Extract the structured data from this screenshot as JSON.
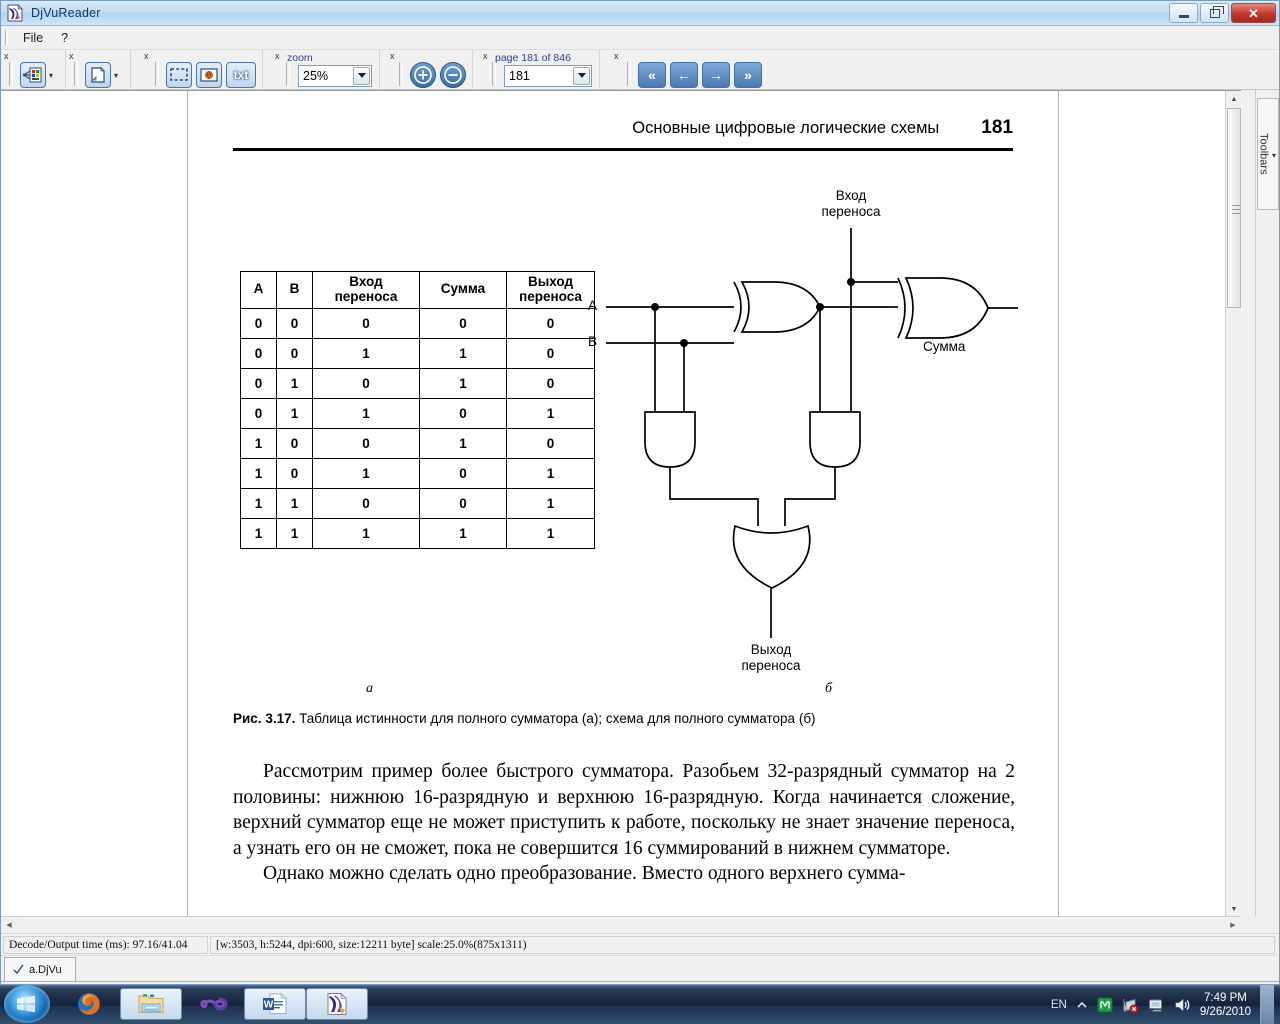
{
  "window": {
    "title": "DjVuReader",
    "icon": "djvu-document-icon",
    "buttons": {
      "minimize": "–",
      "maximize": "❐",
      "close": "✕"
    }
  },
  "menubar": {
    "items": [
      "File",
      "?"
    ]
  },
  "toolbar": {
    "close_glyph": "x",
    "groups": [
      {
        "name": "display-mode",
        "buttons": [
          "display-mode-icon"
        ],
        "has_dropdown": true
      },
      {
        "name": "page-layout",
        "buttons": [
          "page-layout-icon"
        ],
        "has_dropdown": true
      },
      {
        "name": "tools",
        "buttons": [
          "select-area-icon",
          "image-mode-icon",
          "txt"
        ]
      }
    ],
    "zoom": {
      "label": "zoom",
      "value": "25%"
    },
    "zoom_in": "+",
    "zoom_out": "−",
    "page": {
      "label": "page 181 of 846",
      "value": "181"
    },
    "nav": {
      "first": "«",
      "prev": "←",
      "next": "→",
      "last": "»"
    }
  },
  "dock": {
    "label": "Toolbars",
    "chevron": "▾"
  },
  "statusbar": {
    "left": "Decode/Output time (ms): 97.16/41.04",
    "right": "[w:3503, h:5244, dpi:600, size:12211 byte] scale:25.0%(875x1311)"
  },
  "tabstrip": {
    "tab_name": "a.DjVu",
    "tab_icon": "checkmark-icon"
  },
  "scrollbars": {
    "up": "▲",
    "down": "▼",
    "left": "◀",
    "right": "▶"
  },
  "document": {
    "running_head": "Основные цифровые логические схемы",
    "page_number": "181",
    "truth_table": {
      "headers": [
        "A",
        "B",
        "Вход переноса",
        "Сумма",
        "Выход переноса"
      ],
      "rows": [
        [
          "0",
          "0",
          "0",
          "0",
          "0"
        ],
        [
          "0",
          "0",
          "1",
          "1",
          "0"
        ],
        [
          "0",
          "1",
          "0",
          "1",
          "0"
        ],
        [
          "0",
          "1",
          "1",
          "0",
          "1"
        ],
        [
          "1",
          "0",
          "0",
          "1",
          "0"
        ],
        [
          "1",
          "0",
          "1",
          "0",
          "1"
        ],
        [
          "1",
          "1",
          "0",
          "0",
          "1"
        ],
        [
          "1",
          "1",
          "1",
          "1",
          "1"
        ]
      ]
    },
    "circuit": {
      "input_a": "A",
      "input_b": "B",
      "carry_in": "Вход\nпереноса",
      "sum": "Сумма",
      "carry_out": "Выход\nпереноса"
    },
    "sublabel_a": "а",
    "sublabel_b": "б",
    "caption_bold": "Рис. 3.17.",
    "caption_text": " Таблица истинности для полного сумматора (а); схема для полного сумматора (б)",
    "paragraphs": [
      "Рассмотрим пример более быстрого сумматора. Разобьем 32-разрядный сумматор на 2 половины: нижнюю 16-разрядную и верхнюю 16-разрядную. Когда начинается сложение, верхний сумматор еще не может приступить к работе, поскольку не знает значение переноса, а узнать его он не сможет, пока не совершится 16 суммирований в нижнем сумматоре.",
      "Однако можно сделать одно преобразование. Вместо одного верхнего сумма-"
    ]
  },
  "taskbar": {
    "start": "start-orb",
    "items": [
      "firefox-icon",
      "explorer-folder-icon",
      "infinity-app-icon",
      "word-icon",
      "djvureader-icon"
    ],
    "tray": {
      "language": "EN",
      "overflow": "show-hidden-icons-chevron",
      "icons": [
        "green-app-icon",
        "network-error-icon",
        "monitor-icon",
        "volume-icon"
      ],
      "time": "7:49 PM",
      "date": "9/26/2010"
    }
  },
  "colors": {
    "accent": "#4a78ae",
    "title_text": "#14375e",
    "label_blue": "#2b3ea8",
    "close_red": "#c0362c"
  }
}
